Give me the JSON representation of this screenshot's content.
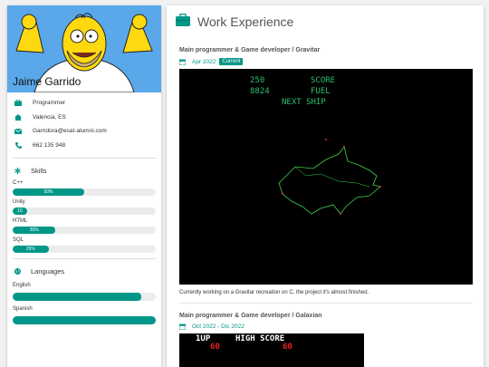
{
  "profile": {
    "name": "Jaime Garrido",
    "role": "Programmer",
    "location": "Valencia, ES",
    "email": "Garridora@esat-alumni.com",
    "phone": "662 135 948"
  },
  "skills": {
    "title": "Skills",
    "items": [
      {
        "label": "C++",
        "percent": 50,
        "text": "50%"
      },
      {
        "label": "Unity",
        "percent": 10,
        "text": "10"
      },
      {
        "label": "HTML",
        "percent": 30,
        "text": "30%"
      },
      {
        "label": "SQL",
        "percent": 25,
        "text": "25%"
      }
    ]
  },
  "languages": {
    "title": "Languages",
    "items": [
      {
        "label": "English",
        "percent": 90
      },
      {
        "label": "Spanish",
        "percent": 100
      }
    ]
  },
  "experience": {
    "title": "Work Experience",
    "jobs": [
      {
        "title": "Main programmer & Game developer / Gravitar",
        "date": "Apr 2022",
        "badge": "Current",
        "desc": "Currently working on a Gravitar recreation on C, the project it's almost finished.",
        "hud": {
          "score_val": "250",
          "score_lbl": "SCORE",
          "fuel_val": "8824",
          "fuel_lbl": "FUEL",
          "next": "NEXT SHIP"
        }
      },
      {
        "title": "Main programmer & Game developer / Galaxian",
        "date": "Oct 2022 - Dic 2022",
        "hud": {
          "p1": "1UP",
          "hs": "HIGH SCORE",
          "v1": "60",
          "v2": "60"
        }
      }
    ]
  },
  "colors": {
    "accent": "#009688"
  }
}
